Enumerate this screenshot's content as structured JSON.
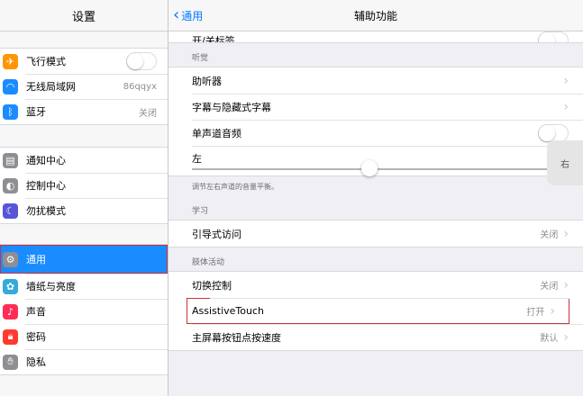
{
  "sidebar": {
    "title": "设置",
    "groups": [
      {
        "items": [
          {
            "label": "飞行模式",
            "icon": "airplane-icon",
            "color": "#ff9500"
          },
          {
            "label": "无线局域网",
            "icon": "wifi-icon",
            "color": "#1a8cff",
            "value": "86qqyx"
          },
          {
            "label": "蓝牙",
            "icon": "bluetooth-icon",
            "color": "#1a8cff",
            "value": "关闭"
          }
        ]
      },
      {
        "items": [
          {
            "label": "通知中心",
            "icon": "notification-icon",
            "color": "#8e8e93"
          },
          {
            "label": "控制中心",
            "icon": "control-center-icon",
            "color": "#8e8e93"
          },
          {
            "label": "勿扰模式",
            "icon": "moon-icon",
            "color": "#5856d6"
          }
        ]
      },
      {
        "items": [
          {
            "label": "通用",
            "icon": "gear-icon",
            "color": "#8e8e93"
          },
          {
            "label": "墙纸与亮度",
            "icon": "flower-icon",
            "color": "#34aadc"
          },
          {
            "label": "声音",
            "icon": "speaker-icon",
            "color": "#ff2d55"
          },
          {
            "label": "密码",
            "icon": "lock-icon",
            "color": "#ff3b30"
          },
          {
            "label": "隐私",
            "icon": "hand-icon",
            "color": "#8e8e93"
          }
        ]
      }
    ]
  },
  "main": {
    "back_label": "通用",
    "title": "辅助功能",
    "partial_row": "开/关标签",
    "hearing_label": "听觉",
    "hearing_items": {
      "hearing_aids": "助听器",
      "subtitles": "字幕与隐藏式字幕",
      "mono_audio": "单声道音频",
      "left": "左",
      "right": "右"
    },
    "balance_note": "调节左右声道的音量平衡。",
    "balance_level": 0.5,
    "learning_label": "学习",
    "guided_access": {
      "label": "引导式访问",
      "value": "关闭"
    },
    "physical_label": "肢体活动",
    "switch_control": {
      "label": "切换控制",
      "value": "关闭"
    },
    "assistive_touch": {
      "label": "AssistiveTouch",
      "value": "打开"
    },
    "home_click": {
      "label": "主屏幕按钮点按速度",
      "value": "默认"
    }
  },
  "colors": {
    "accent": "#1a8cff",
    "highlight_border": "#c9333b"
  }
}
